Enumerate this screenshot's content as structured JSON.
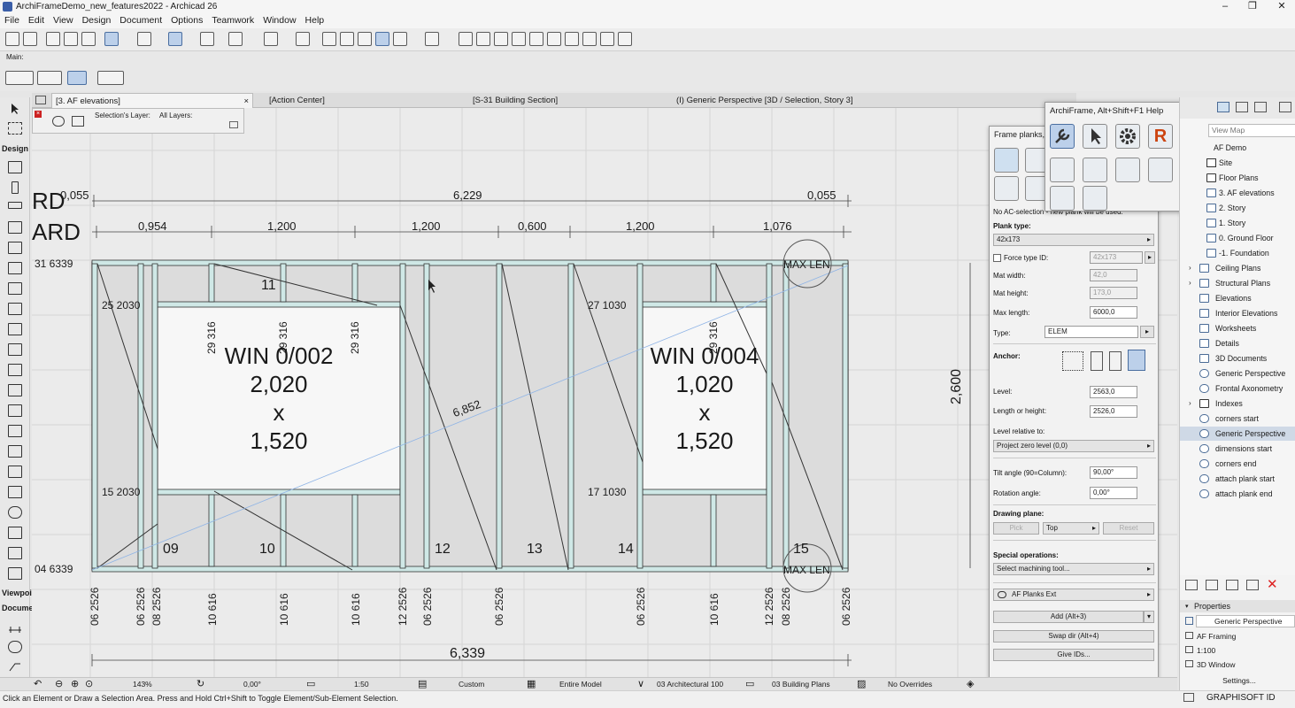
{
  "window": {
    "title": "ArchiFrameDemo_new_features2022 - Archicad 26",
    "controls": [
      "–",
      "❐",
      "✕"
    ]
  },
  "menu": [
    "File",
    "Edit",
    "View",
    "Design",
    "Document",
    "Options",
    "Teamwork",
    "Window",
    "Help"
  ],
  "toolbar2": {
    "label": "Main:"
  },
  "toolbox": {
    "labels": {
      "design": "Design",
      "viewpoint": "Viewpoi",
      "document": "Docume"
    }
  },
  "tabs": [
    {
      "label": "[3. AF elevations]",
      "close": "×"
    },
    {
      "label": "[Action Center]"
    },
    {
      "label": "[S-31 Building Section]"
    },
    {
      "label": "(I) Generic Perspective [3D / Selection, Story 3]"
    }
  ],
  "quick_options": {
    "selections_layer": "Selection's Layer:",
    "all_layers": "All Layers:"
  },
  "drawing": {
    "left_text": [
      "RD",
      "ARD"
    ],
    "top_total": "6,229",
    "top_left_small": "0,055",
    "top_right_small": "0,055",
    "segments": [
      "0,954",
      "1,200",
      "1,200",
      "0,600",
      "1,200",
      "1,076"
    ],
    "row_top": "31  6339",
    "row_bottom": "04  6339",
    "bottom_total": "6,339",
    "height_dim": "2,600",
    "diag": "6,852",
    "window1": {
      "line1": "WIN 0/002",
      "line2": "2,020",
      "line3": "x",
      "line4": "1,520"
    },
    "window2": {
      "line1": "WIN 0/004",
      "line2": "1,020",
      "line3": "x",
      "line4": "1,520"
    },
    "max_len_top": "MAX LEN",
    "max_len_bottom": "MAX LEN",
    "labels": {
      "l25": "25  2030",
      "l15": "15  2030",
      "l27": "27  1030",
      "l17": "17  1030",
      "n11": "11",
      "n09": "09",
      "n10": "10",
      "n12": "12",
      "n13": "13",
      "n14": "14",
      "n15": "15",
      "v1": "29 316",
      "v2": "29 316",
      "v3": "29 316",
      "v4": "29 316"
    },
    "bottom_labels": [
      "06 2526",
      "06 2526",
      "08 2526",
      "10 616",
      "10 616",
      "10 616",
      "12 2526",
      "06 2526",
      "06 2526",
      "06 2526",
      "10 616",
      "12 2526",
      "08 2526",
      "06 2526"
    ]
  },
  "planks_panel": {
    "title": "Frame planks,",
    "info": "No AC-selection - new plank will be used:",
    "plank_type_label": "Plank type:",
    "plank_type": "42x173",
    "force_type_label": "Force type ID:",
    "force_type_value": "42x173",
    "mat_width_label": "Mat width:",
    "mat_width": "42,0",
    "mat_height_label": "Mat height:",
    "mat_height": "173,0",
    "max_length_label": "Max length:",
    "max_length": "6000,0",
    "type_label": "Type:",
    "type": "ELEM",
    "anchor_label": "Anchor:",
    "level_label": "Level:",
    "level": "2563,0",
    "length_label": "Length or height:",
    "length": "2526,0",
    "level_rel_label": "Level relative to:",
    "level_rel": "Project zero level (0,0)",
    "tilt_label": "Tilt angle (90=Column):",
    "tilt": "90,00°",
    "rotation_label": "Rotation angle:",
    "rotation": "0,00°",
    "drawing_plane_label": "Drawing plane:",
    "pick": "Pick",
    "plane": "Top",
    "reset": "Reset",
    "special_label": "Special operations:",
    "machining": "Select machining tool...",
    "af_planks": "AF Planks Ext",
    "add": "Add (Alt+3)",
    "swap": "Swap dir (Alt+4)",
    "give_ids": "Give IDs..."
  },
  "help_panel": {
    "title": "ArchiFrame, Alt+Shift+F1 Help",
    "close": "✕",
    "r_icon": "R",
    "q_icon": "?"
  },
  "navigator": {
    "search": "View Map",
    "items": [
      {
        "label": "AF Demo",
        "indent": 0,
        "icon": "project-icon"
      },
      {
        "label": "Site",
        "indent": 1,
        "icon": "story-icon"
      },
      {
        "label": "Floor Plans",
        "indent": 1,
        "icon": "story-icon"
      },
      {
        "label": "3. AF elevations",
        "indent": 2,
        "icon": "story-icon"
      },
      {
        "label": "2. Story",
        "indent": 2,
        "icon": "story-icon"
      },
      {
        "label": "1. Story",
        "indent": 2,
        "icon": "story-icon"
      },
      {
        "label": "0. Ground Floor",
        "indent": 2,
        "icon": "story-icon"
      },
      {
        "label": "-1. Foundation",
        "indent": 2,
        "icon": "story-icon"
      },
      {
        "label": "Ceiling Plans",
        "indent": 1,
        "icon": "folder-icon"
      },
      {
        "label": "Structural Plans",
        "indent": 1,
        "icon": "folder-icon"
      },
      {
        "label": "Elevations",
        "indent": 1,
        "icon": "folder-icon"
      },
      {
        "label": "Interior Elevations",
        "indent": 1,
        "icon": "folder-icon"
      },
      {
        "label": "Worksheets",
        "indent": 1,
        "icon": "folder-icon"
      },
      {
        "label": "Details",
        "indent": 1,
        "icon": "folder-icon"
      },
      {
        "label": "3D Documents",
        "indent": 1,
        "icon": "folder-icon"
      },
      {
        "label": "Generic Perspective",
        "indent": 1,
        "icon": "view-icon"
      },
      {
        "label": "Frontal Axonometry",
        "indent": 1,
        "icon": "view-icon"
      },
      {
        "label": "Indexes",
        "indent": 1,
        "icon": "folder-icon"
      },
      {
        "label": "corners start",
        "indent": 1,
        "icon": "view-icon"
      },
      {
        "label": "Generic Perspective",
        "indent": 1,
        "icon": "view-icon",
        "selected": true
      },
      {
        "label": "dimensions start",
        "indent": 1,
        "icon": "view-icon"
      },
      {
        "label": "corners end",
        "indent": 1,
        "icon": "view-icon"
      },
      {
        "label": "attach plank start",
        "indent": 1,
        "icon": "view-icon"
      },
      {
        "label": "attach plank end",
        "indent": 1,
        "icon": "view-icon"
      }
    ]
  },
  "properties": {
    "header": "Properties",
    "name": "Generic Perspective",
    "af_framing": "AF Framing",
    "scale": "1:100",
    "window": "3D Window",
    "settings": "Settings..."
  },
  "statusbar": {
    "zoom": "143%",
    "angle": "0,00°",
    "scale": "1:50",
    "layer": "Custom",
    "model": "Entire Model",
    "pen": "03 Architectural 100",
    "set": "03 Building Plans",
    "override": "No Overrides"
  },
  "hint": "Click an Element or Draw a Selection Area. Press and Hold Ctrl+Shift to Toggle Element/Sub-Element Selection.",
  "brand": "GRAPHISOFT ID"
}
